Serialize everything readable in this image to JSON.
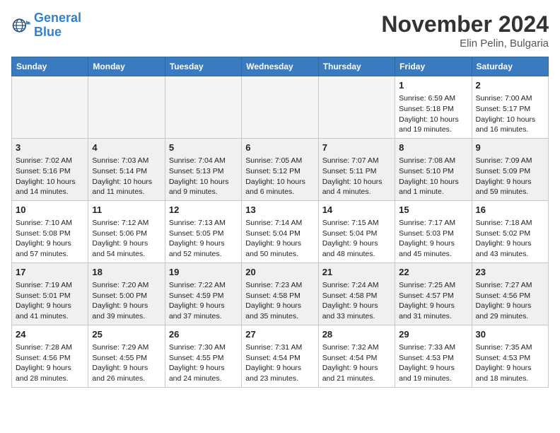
{
  "header": {
    "logo_line1": "General",
    "logo_line2": "Blue",
    "month_title": "November 2024",
    "location": "Elin Pelin, Bulgaria"
  },
  "weekdays": [
    "Sunday",
    "Monday",
    "Tuesday",
    "Wednesday",
    "Thursday",
    "Friday",
    "Saturday"
  ],
  "weeks": [
    [
      {
        "day": "",
        "info": ""
      },
      {
        "day": "",
        "info": ""
      },
      {
        "day": "",
        "info": ""
      },
      {
        "day": "",
        "info": ""
      },
      {
        "day": "",
        "info": ""
      },
      {
        "day": "1",
        "info": "Sunrise: 6:59 AM\nSunset: 5:18 PM\nDaylight: 10 hours\nand 19 minutes."
      },
      {
        "day": "2",
        "info": "Sunrise: 7:00 AM\nSunset: 5:17 PM\nDaylight: 10 hours\nand 16 minutes."
      }
    ],
    [
      {
        "day": "3",
        "info": "Sunrise: 7:02 AM\nSunset: 5:16 PM\nDaylight: 10 hours\nand 14 minutes."
      },
      {
        "day": "4",
        "info": "Sunrise: 7:03 AM\nSunset: 5:14 PM\nDaylight: 10 hours\nand 11 minutes."
      },
      {
        "day": "5",
        "info": "Sunrise: 7:04 AM\nSunset: 5:13 PM\nDaylight: 10 hours\nand 9 minutes."
      },
      {
        "day": "6",
        "info": "Sunrise: 7:05 AM\nSunset: 5:12 PM\nDaylight: 10 hours\nand 6 minutes."
      },
      {
        "day": "7",
        "info": "Sunrise: 7:07 AM\nSunset: 5:11 PM\nDaylight: 10 hours\nand 4 minutes."
      },
      {
        "day": "8",
        "info": "Sunrise: 7:08 AM\nSunset: 5:10 PM\nDaylight: 10 hours\nand 1 minute."
      },
      {
        "day": "9",
        "info": "Sunrise: 7:09 AM\nSunset: 5:09 PM\nDaylight: 9 hours\nand 59 minutes."
      }
    ],
    [
      {
        "day": "10",
        "info": "Sunrise: 7:10 AM\nSunset: 5:08 PM\nDaylight: 9 hours\nand 57 minutes."
      },
      {
        "day": "11",
        "info": "Sunrise: 7:12 AM\nSunset: 5:06 PM\nDaylight: 9 hours\nand 54 minutes."
      },
      {
        "day": "12",
        "info": "Sunrise: 7:13 AM\nSunset: 5:05 PM\nDaylight: 9 hours\nand 52 minutes."
      },
      {
        "day": "13",
        "info": "Sunrise: 7:14 AM\nSunset: 5:04 PM\nDaylight: 9 hours\nand 50 minutes."
      },
      {
        "day": "14",
        "info": "Sunrise: 7:15 AM\nSunset: 5:04 PM\nDaylight: 9 hours\nand 48 minutes."
      },
      {
        "day": "15",
        "info": "Sunrise: 7:17 AM\nSunset: 5:03 PM\nDaylight: 9 hours\nand 45 minutes."
      },
      {
        "day": "16",
        "info": "Sunrise: 7:18 AM\nSunset: 5:02 PM\nDaylight: 9 hours\nand 43 minutes."
      }
    ],
    [
      {
        "day": "17",
        "info": "Sunrise: 7:19 AM\nSunset: 5:01 PM\nDaylight: 9 hours\nand 41 minutes."
      },
      {
        "day": "18",
        "info": "Sunrise: 7:20 AM\nSunset: 5:00 PM\nDaylight: 9 hours\nand 39 minutes."
      },
      {
        "day": "19",
        "info": "Sunrise: 7:22 AM\nSunset: 4:59 PM\nDaylight: 9 hours\nand 37 minutes."
      },
      {
        "day": "20",
        "info": "Sunrise: 7:23 AM\nSunset: 4:58 PM\nDaylight: 9 hours\nand 35 minutes."
      },
      {
        "day": "21",
        "info": "Sunrise: 7:24 AM\nSunset: 4:58 PM\nDaylight: 9 hours\nand 33 minutes."
      },
      {
        "day": "22",
        "info": "Sunrise: 7:25 AM\nSunset: 4:57 PM\nDaylight: 9 hours\nand 31 minutes."
      },
      {
        "day": "23",
        "info": "Sunrise: 7:27 AM\nSunset: 4:56 PM\nDaylight: 9 hours\nand 29 minutes."
      }
    ],
    [
      {
        "day": "24",
        "info": "Sunrise: 7:28 AM\nSunset: 4:56 PM\nDaylight: 9 hours\nand 28 minutes."
      },
      {
        "day": "25",
        "info": "Sunrise: 7:29 AM\nSunset: 4:55 PM\nDaylight: 9 hours\nand 26 minutes."
      },
      {
        "day": "26",
        "info": "Sunrise: 7:30 AM\nSunset: 4:55 PM\nDaylight: 9 hours\nand 24 minutes."
      },
      {
        "day": "27",
        "info": "Sunrise: 7:31 AM\nSunset: 4:54 PM\nDaylight: 9 hours\nand 23 minutes."
      },
      {
        "day": "28",
        "info": "Sunrise: 7:32 AM\nSunset: 4:54 PM\nDaylight: 9 hours\nand 21 minutes."
      },
      {
        "day": "29",
        "info": "Sunrise: 7:33 AM\nSunset: 4:53 PM\nDaylight: 9 hours\nand 19 minutes."
      },
      {
        "day": "30",
        "info": "Sunrise: 7:35 AM\nSunset: 4:53 PM\nDaylight: 9 hours\nand 18 minutes."
      }
    ]
  ]
}
